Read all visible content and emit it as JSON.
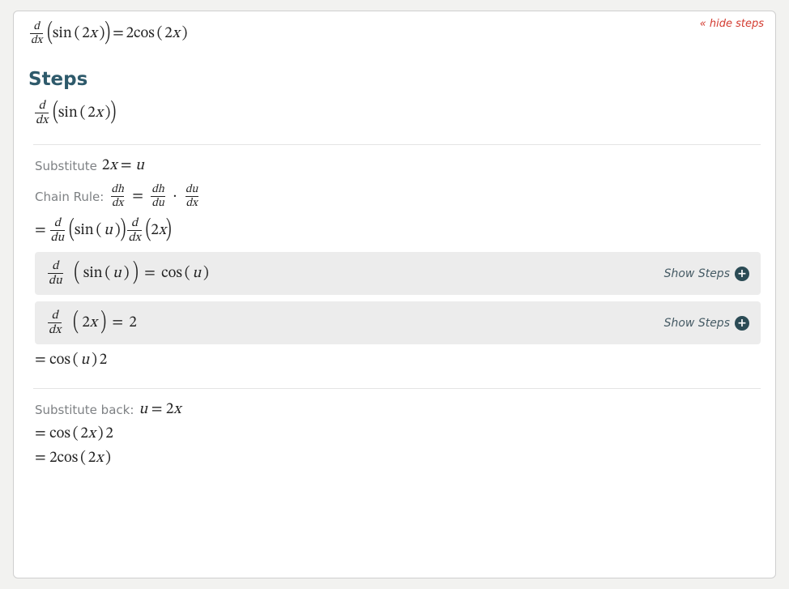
{
  "header": {
    "hide_steps_label": "« hide steps"
  },
  "main_result": {
    "lhs_frac_top": "d",
    "lhs_frac_bot": "dx",
    "lhs_body": "( sin ( 2x ) )",
    "eq": "=",
    "rhs": "2cos ( 2x )"
  },
  "steps_title": "Steps",
  "step0": {
    "frac_top": "d",
    "frac_bot": "dx",
    "body": "( sin ( 2x ) )"
  },
  "notes": {
    "substitute_label": "Substitute",
    "substitute_expr": "2x = u",
    "chain_rule_label": "Chain Rule:",
    "chain_lhs_top": "dh",
    "chain_lhs_bot": "dx",
    "chain_eq": "=",
    "chain_r1_top": "dh",
    "chain_r1_bot": "du",
    "chain_dot": "·",
    "chain_r2_top": "du",
    "chain_r2_bot": "dx"
  },
  "chain_expand": {
    "eq": "=",
    "f1_top": "d",
    "f1_bot": "du",
    "mid1": "( sin ( u ) )",
    "f2_top": "d",
    "f2_bot": "dx",
    "mid2": "( 2x )"
  },
  "sub1": {
    "frac_top": "d",
    "frac_bot": "du",
    "lhs": "( sin ( u ) )",
    "eq": "=",
    "rhs": "cos ( u )",
    "show_label": "Show Steps"
  },
  "sub2": {
    "frac_top": "d",
    "frac_bot": "dx",
    "lhs": "( 2x )",
    "eq": "=",
    "rhs": "2",
    "show_label": "Show Steps"
  },
  "combine": {
    "line": "= cos ( u ) 2"
  },
  "back": {
    "label": "Substitute back:",
    "expr": "u = 2x",
    "line1": "= cos ( 2x ) 2",
    "line2": "= 2cos ( 2x )"
  }
}
